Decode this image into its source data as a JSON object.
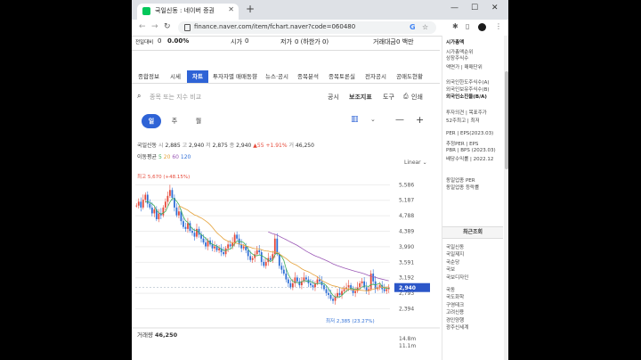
{
  "browser": {
    "tab_title": "국일신동 : 네이버 증권",
    "url": "finance.naver.com/item/fchart.naver?code=060480",
    "new_tab": "+",
    "win_min": "—",
    "win_max": "☐",
    "win_close": "✕"
  },
  "quote": {
    "prev_label": "전일대비",
    "prev_value": "0",
    "rate": "0.00%",
    "open_label": "시가",
    "open_value": "0",
    "low_label": "저가",
    "low_value": "0 (하한가 0)",
    "trade_amount_label": "거래대금",
    "trade_amount_value": "0 백만"
  },
  "subtabs": [
    "종합정보",
    "시세",
    "차트",
    "투자자별 매매동향",
    "뉴스·공시",
    "종목분석",
    "종목토론실",
    "전자공시",
    "공매도현황"
  ],
  "toolbar": {
    "search_placeholder": "종목 또는 지수 비교",
    "notice": "공시",
    "indicator": "보조지표",
    "tools": "도구",
    "print": "인쇄"
  },
  "periods": [
    "일",
    "주",
    "월"
  ],
  "ohlc": {
    "name": "국일신동",
    "open_label": "시",
    "open": "2,885",
    "high_label": "고",
    "high": "2,940",
    "low_label": "저",
    "low": "2,875",
    "close_label": "종",
    "close": "2,940",
    "change": "▲55",
    "change_rate": "+1.91%",
    "volume_label": "거",
    "volume": "46,250"
  },
  "ma": {
    "label": "이동평균",
    "p1": "5",
    "p2": "20",
    "p3": "60",
    "p4": "120"
  },
  "scale_mode": "Linear",
  "volume_text": {
    "label": "거래량",
    "value": "46,250"
  },
  "chart_data": {
    "type": "candlestick",
    "y_ticks": [
      "5,586",
      "5,187",
      "4,788",
      "4,389",
      "3,990",
      "3,591",
      "3,192",
      "2,793",
      "2,394"
    ],
    "ylim": [
      2200,
      5800
    ],
    "last_price_label": "2,940",
    "high_annotation": "최고 5,670 (+48.15%)",
    "low_annotation": "최저 2,385 (23.27%)",
    "volume_ticks": [
      "14.8m",
      "11.1m"
    ],
    "closes": [
      5050,
      5150,
      5000,
      5200,
      5330,
      5100,
      5000,
      4850,
      4950,
      4700,
      4850,
      4800,
      5000,
      5150,
      5300,
      5450,
      5250,
      5000,
      4800,
      4900,
      4650,
      4500,
      4450,
      4600,
      4400,
      4350,
      4250,
      4450,
      4300,
      4200,
      4100,
      4000,
      4150,
      4050,
      3950,
      4000,
      3900,
      3950,
      3850,
      3800,
      3950,
      4050,
      4000,
      4100,
      4300,
      4200,
      4050,
      3950,
      4000,
      3900,
      3750,
      3650,
      3700,
      3800,
      3900,
      3850,
      3600,
      3500,
      3600,
      3700,
      3650,
      3800,
      4200,
      3800,
      3500,
      3400,
      3300,
      3150,
      3050,
      2950,
      3050,
      3200,
      3100,
      3000,
      3100,
      3200,
      3150,
      3050,
      3000,
      2950,
      3050,
      3150,
      3100,
      3000,
      2900,
      2800,
      2750,
      2650,
      2600,
      2700,
      2800,
      2750,
      2850,
      2900,
      2950,
      3000,
      2900,
      2800,
      2850,
      2950,
      3050,
      3100,
      2950,
      2850,
      2900,
      3300,
      3100,
      2900,
      2950,
      3000,
      2900,
      2850,
      2900,
      2940
    ],
    "colors": {
      "up": "#e64a3a",
      "down": "#2f6fd6",
      "ma5": "#3fae5a",
      "ma20": "#e5a23a",
      "ma60": "#9b59b6",
      "price_tag": "#2b56c8"
    }
  },
  "sidebar": {
    "items": [
      "시가총액",
      "시가총액순위",
      "상장주식수",
      "액면가 | 매매단위",
      "외국인한도주식수(A)",
      "외국인보유주식수(B)",
      "외국인소진율(B/A)",
      "투자의견 | 목표주가",
      "52주최고 | 최저",
      "PER | EPS(2023.03)",
      "추정PER | EPS",
      "PBR | BPS (2023.03)",
      "배당수익률 | 2022.12",
      "동일업종 PER",
      "동일업종 등락률"
    ],
    "recent_title": "최근조회",
    "recent": [
      "국일신동",
      "국일제지",
      "국순당",
      "국보",
      "국보디자인",
      "국동",
      "국도화학",
      "구영테크",
      "고려신용",
      "경인양행",
      "광주신세계"
    ]
  }
}
